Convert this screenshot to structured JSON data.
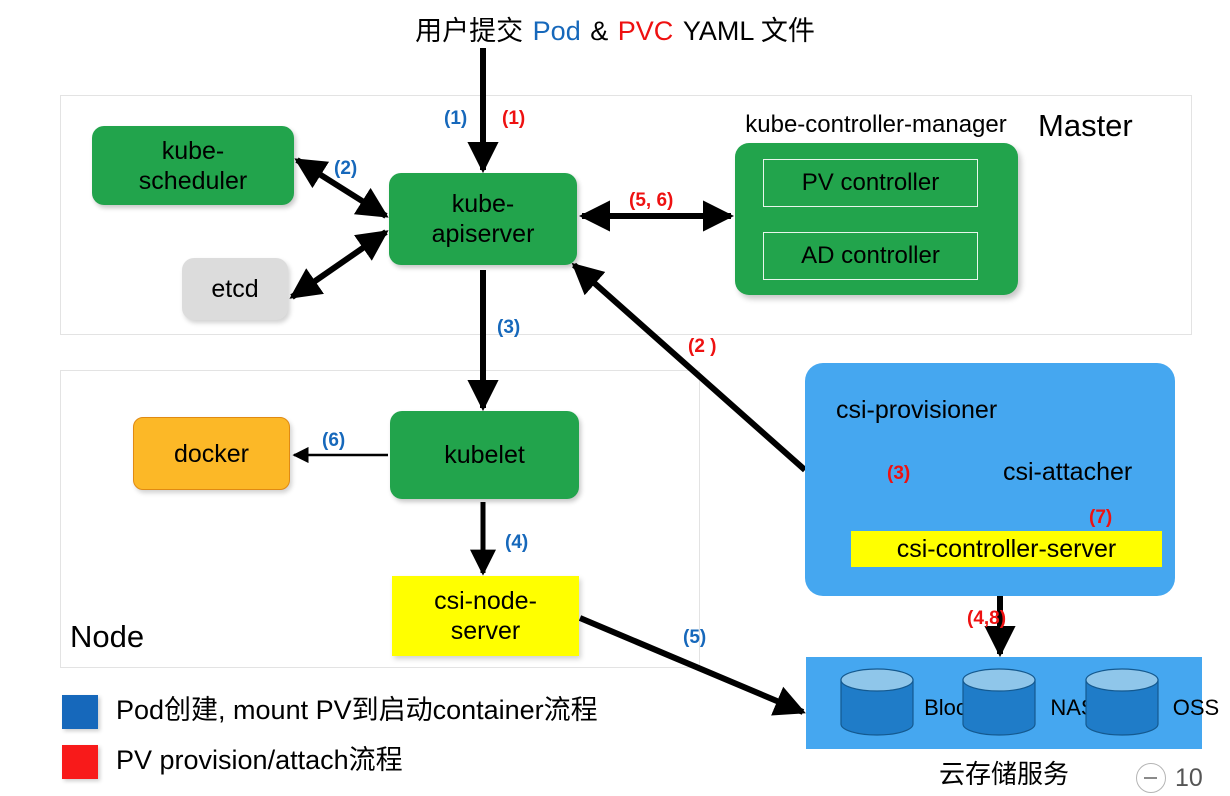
{
  "headline": {
    "prefix": "用户提交",
    "pod": "Pod",
    "amp": "&",
    "pvc": "PVC",
    "suffix": "YAML 文件"
  },
  "regions": {
    "master_title": "Master",
    "node_title": "Node"
  },
  "master": {
    "kube_scheduler": "kube-\nscheduler",
    "kube_apiserver": "kube-\napiserver",
    "etcd": "etcd",
    "controller_manager_label": "kube-controller-manager",
    "pv_controller": "PV controller",
    "ad_controller": "AD controller"
  },
  "node": {
    "kubelet": "kubelet",
    "docker": "docker",
    "csi_node_server": "csi-node-\nserver"
  },
  "csi_panel": {
    "provisioner": "csi-provisioner",
    "attacher": "csi-attacher",
    "controller_server": "csi-controller-server"
  },
  "storage": {
    "caption": "云存储服务",
    "disks": [
      {
        "label": "Block"
      },
      {
        "label": "NAS"
      },
      {
        "label": "OSS"
      }
    ]
  },
  "legend": [
    {
      "color": "#1668bb",
      "text": "Pod创建, mount PV到启动container流程"
    },
    {
      "color": "#f81a1a",
      "text": "PV provision/attach流程"
    }
  ],
  "steps": {
    "b1": "(1)",
    "r1": "(1)",
    "b2": "(2)",
    "r56": "(5, 6)",
    "b3": "(3)",
    "r2": "(2 )",
    "b6": "(6)",
    "r3": "(3)",
    "r7": "(7)",
    "b4": "(4)",
    "r48": "(4,8)",
    "b5": "(5)"
  },
  "zoom_widget": {
    "level": "10"
  },
  "colors": {
    "green": "#22a44c",
    "orange": "#fcb827",
    "gray": "#dcdcdc",
    "yellow": "#ffff00",
    "panel_blue": "#45a7f0",
    "cyl_blue": "#1f7cc8",
    "cyl_top": "#8fc6ea",
    "flow_blue": "#1668bb",
    "flow_red": "#f81a1a"
  }
}
